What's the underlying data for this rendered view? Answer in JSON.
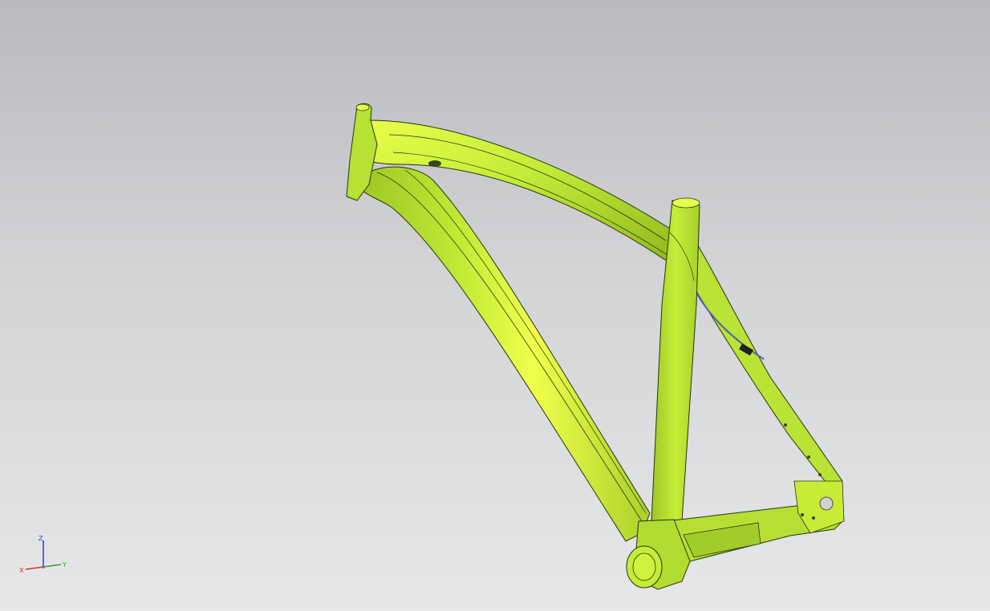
{
  "viewport": {
    "background_top": "#b9babd",
    "background_bottom": "#e6e7e8",
    "model": "bicycle-frame",
    "model_color": "#b5e336",
    "model_highlight": "#eaff4a",
    "model_shadow": "#7fa51c",
    "edge_color": "#2a3310"
  },
  "triad": {
    "x_label": "X",
    "y_label": "Y",
    "z_label": "Z",
    "x_color": "#d03030",
    "y_color": "#2f9a3a",
    "z_color": "#2c3fd0"
  }
}
